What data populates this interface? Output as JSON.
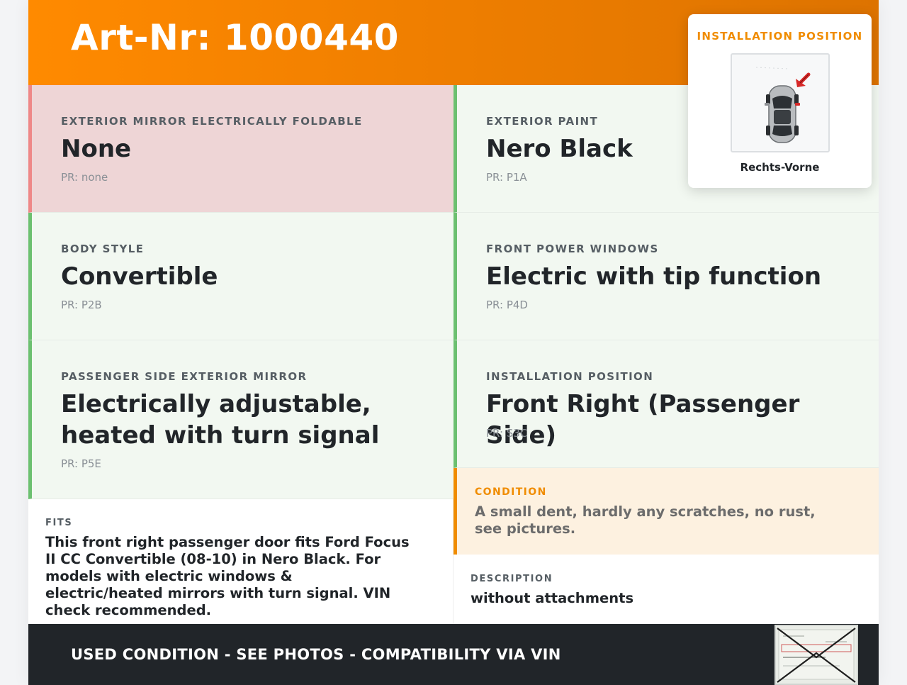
{
  "header": {
    "title": "Art-Nr: 1000440"
  },
  "attributes": [
    {
      "label": "EXTERIOR MIRROR ELECTRICALLY FOLDABLE",
      "value": "None",
      "pr": "PR: none"
    },
    {
      "label": "EXTERIOR PAINT",
      "value": "Nero Black",
      "pr": "PR: P1A"
    },
    {
      "label": "BODY STYLE",
      "value": "Convertible",
      "pr": "PR: P2B"
    },
    {
      "label": "FRONT POWER WINDOWS",
      "value": "Electric with tip function",
      "pr": "PR: P4D"
    },
    {
      "label": "PASSENGER SIDE EXTERIOR MIRROR",
      "value": "Electrically adjustable, heated with turn signal",
      "pr": "PR: P5E"
    },
    {
      "label": "INSTALLATION POSITION",
      "value": "Front Right (Passenger Side)",
      "pr": "PR: S3C"
    }
  ],
  "fits": {
    "label": "FITS",
    "text": "This front right passenger door fits Ford Focus II CC Convertible (08-10) in Nero Black. For models with electric windows & electric/heated mirrors with turn signal. VIN check recommended."
  },
  "condition": {
    "label": "CONDITION",
    "text": "A small dent, hardly any scratches, no rust, see pictures."
  },
  "description": {
    "label": "DESCRIPTION",
    "text": "without attachments"
  },
  "footer": {
    "text": "USED CONDITION - SEE PHOTOS - COMPATIBILITY VIA VIN"
  },
  "install_card": {
    "label": "INSTALLATION POSITION",
    "caption": "Rechts-Vorne",
    "icon": "car-top-view-icon"
  },
  "colors": {
    "accent": "#f08c00",
    "positive_border": "#6cc070",
    "negative_bg": "#eed5d6",
    "footer_bg": "#212529"
  }
}
